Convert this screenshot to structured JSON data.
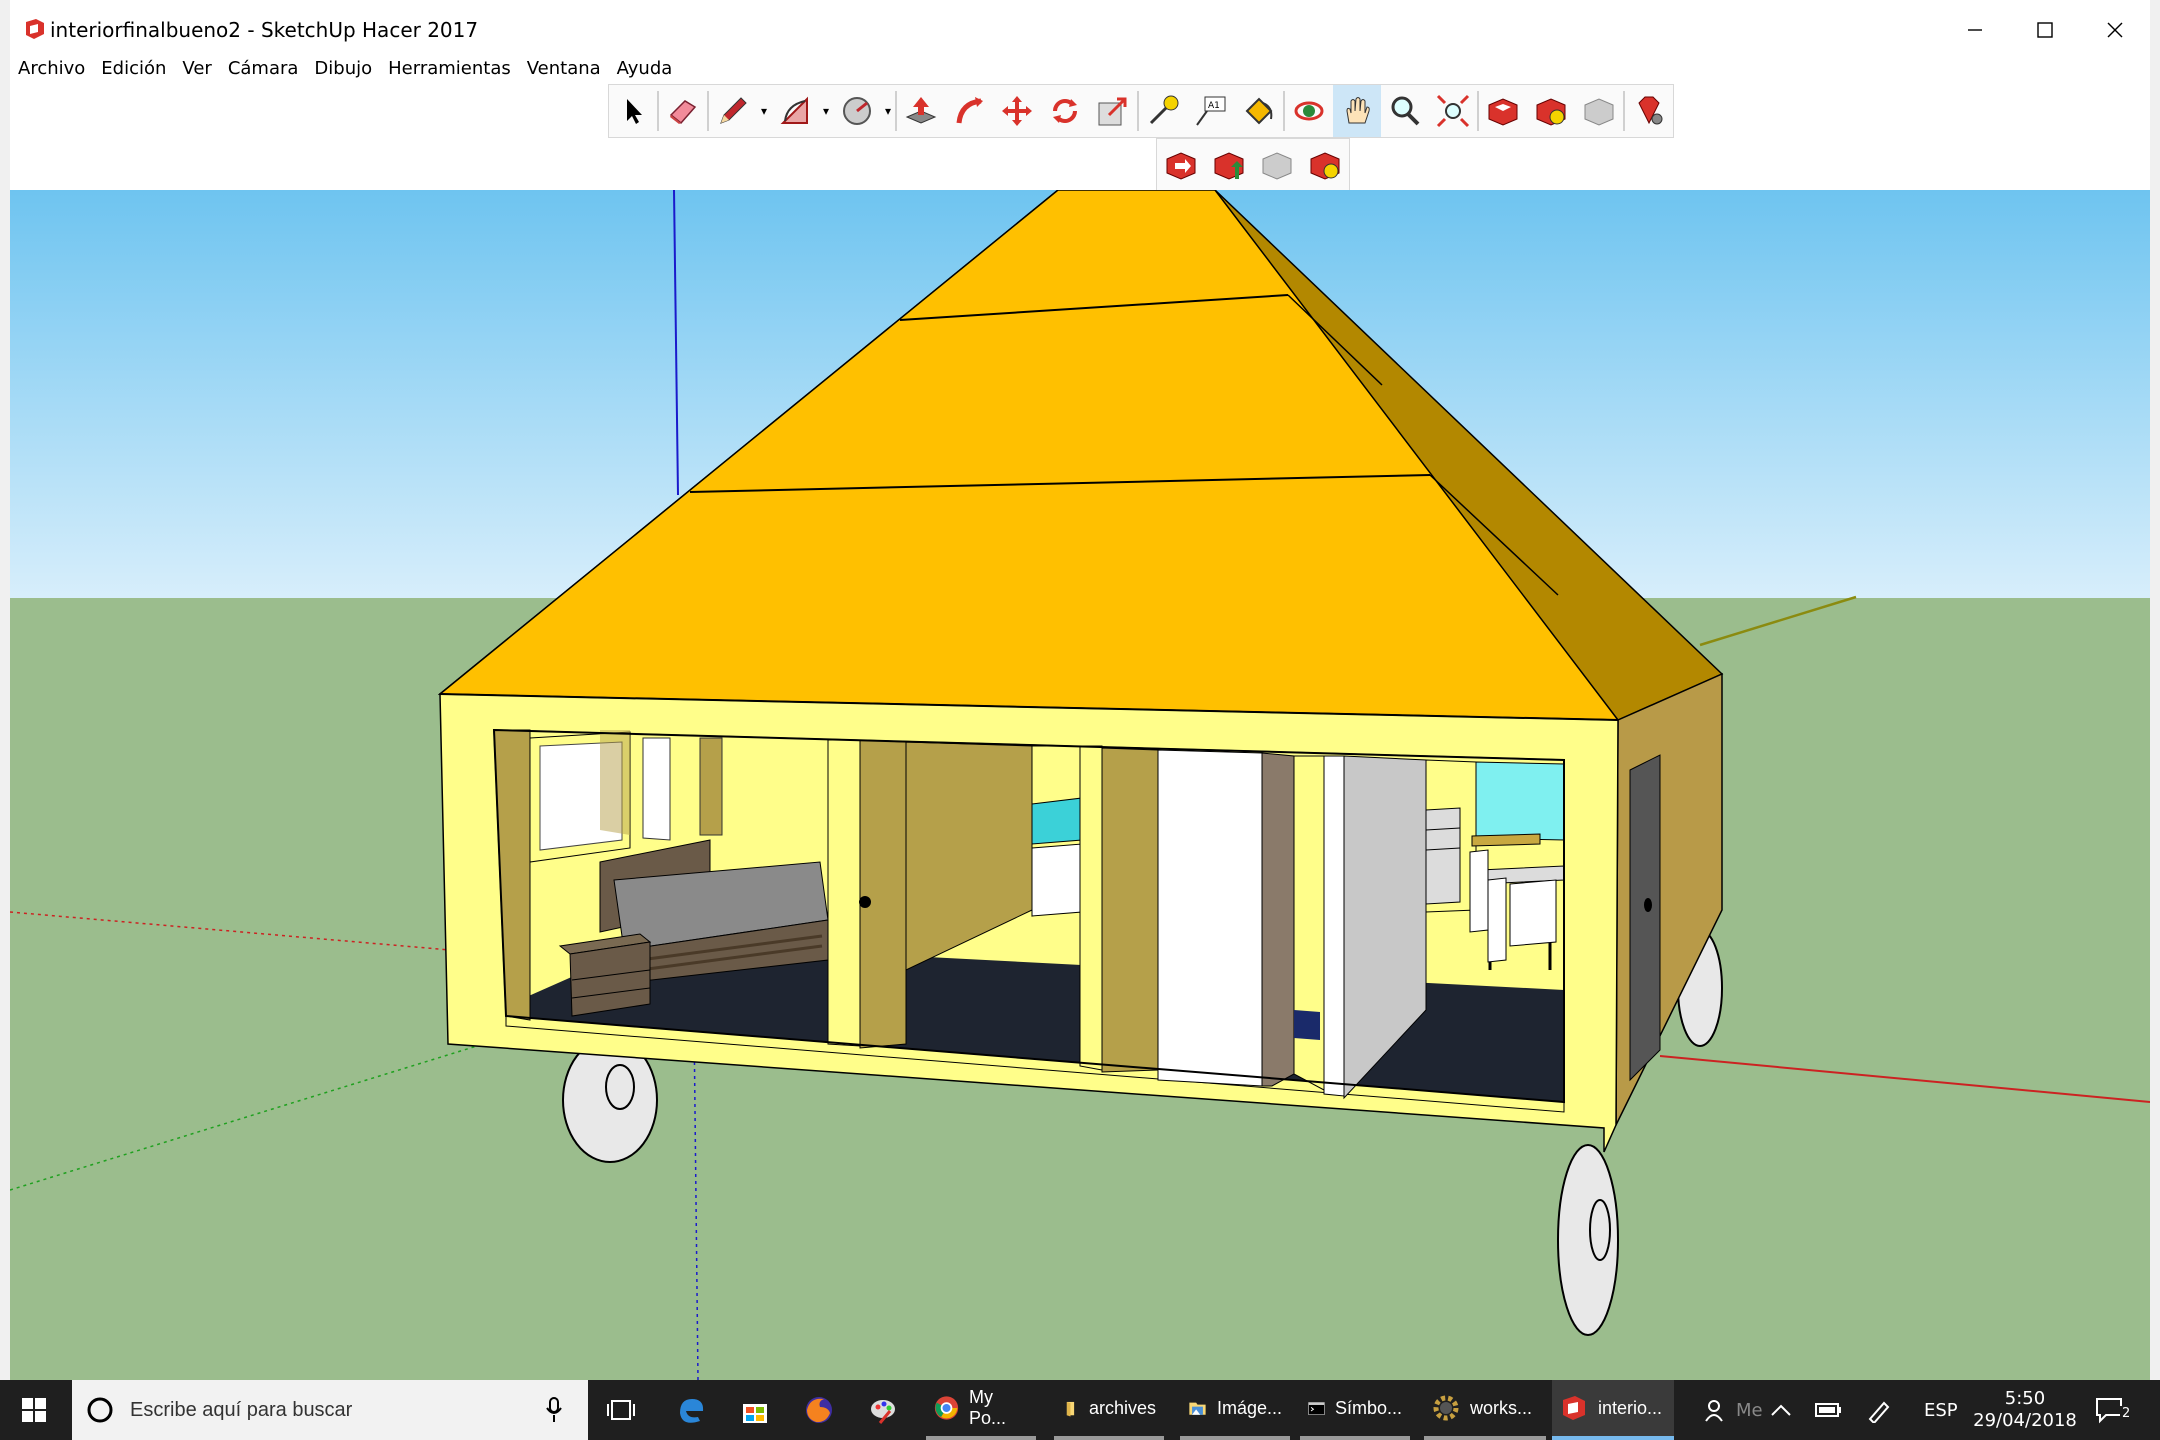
{
  "window": {
    "title": "interiorfinalbueno2 - SketchUp Hacer 2017",
    "minimize": "–",
    "maximize": "☐",
    "close": "✕"
  },
  "menu": [
    "Archivo",
    "Edición",
    "Ver",
    "Cámara",
    "Dibujo",
    "Herramientas",
    "Ventana",
    "Ayuda"
  ],
  "toolbar_main": [
    "select-tool",
    "eraser-tool",
    "pencil-tool",
    "arc-tool",
    "shapes-tool",
    "push-pull-tool",
    "follow-me-tool",
    "move-tool",
    "rotate-tool",
    "scale-tool",
    "tape-measure-tool",
    "text-tool",
    "paint-bucket-tool",
    "orbit-tool",
    "pan-tool",
    "zoom-tool",
    "zoom-extents-tool",
    "warehouse-tool",
    "extension-warehouse-tool",
    "share-model-tool",
    "ruby-console-tool"
  ],
  "toolbar_secondary": [
    "layout-send-tool",
    "layout-import-tool",
    "layout-ref-tool",
    "layout-ext-tool"
  ],
  "scene": {
    "sky_top": "#6ec4f0",
    "sky_bottom": "#d7eefb",
    "ground": "#9bbd8d",
    "roof": "#ffc000",
    "roof_dark": "#b38800",
    "wall": "#fffe8a",
    "wall_dark": "#b5a04a",
    "floor": "#1e2430"
  },
  "taskbar": {
    "search_placeholder": "Escribe aquí para buscar",
    "apps": [
      {
        "label": "My Po...",
        "icon": "chrome-icon"
      },
      {
        "label": "archives",
        "icon": "folder-icon"
      },
      {
        "label": "Imáge...",
        "icon": "image-viewer-icon"
      },
      {
        "label": "Símbo...",
        "icon": "terminal-icon"
      },
      {
        "label": "works...",
        "icon": "gear-app-icon"
      },
      {
        "label": "interio...",
        "icon": "sketchup-icon"
      }
    ],
    "tray": {
      "language": "ESP",
      "time": "5:50",
      "date": "29/04/2018",
      "notifications": "2",
      "people_label": "Me"
    }
  }
}
